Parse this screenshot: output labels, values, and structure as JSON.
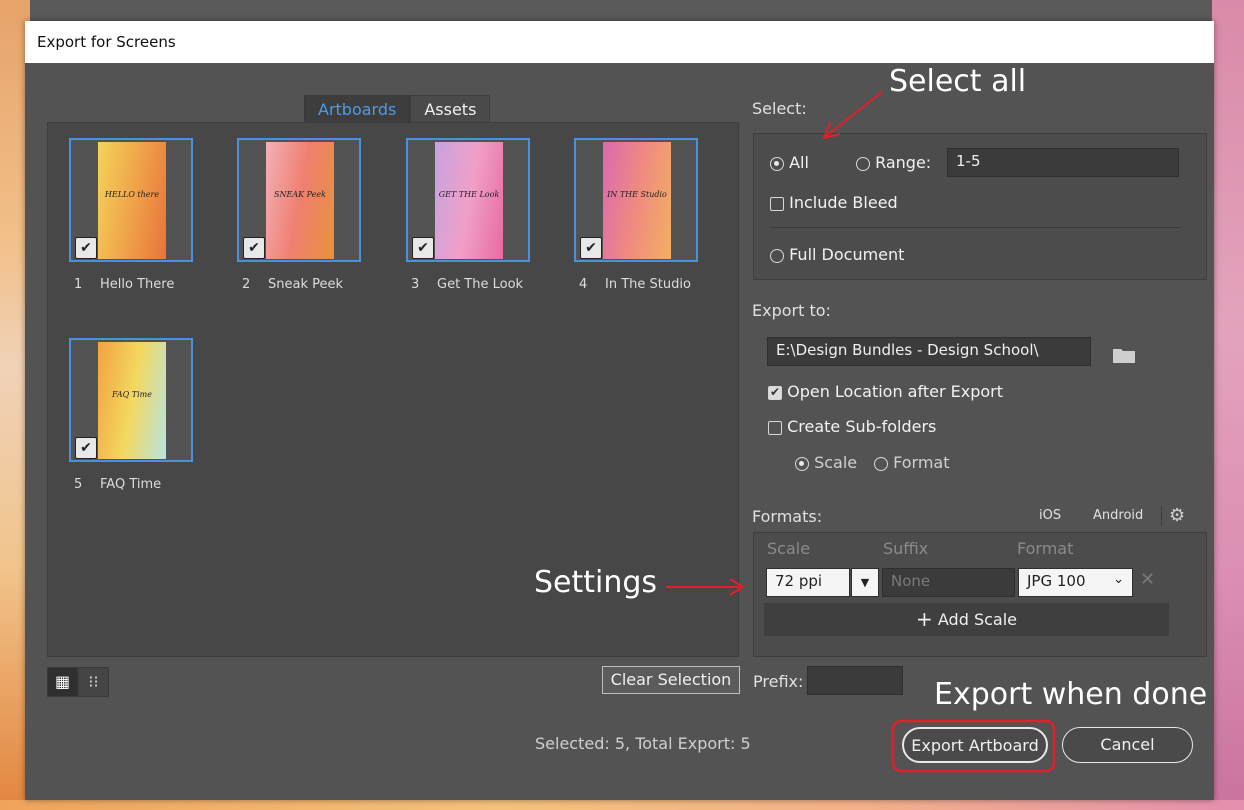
{
  "dialog": {
    "title": "Export for Screens"
  },
  "tabs": [
    "Artboards",
    "Assets"
  ],
  "artboards": [
    {
      "num": "1",
      "name": "Hello There",
      "checked": true,
      "art_word": "HELLO there",
      "colors": [
        "#f3d45a",
        "#f0a44a",
        "#e8733a"
      ]
    },
    {
      "num": "2",
      "name": "Sneak Peek",
      "checked": true,
      "art_word": "SNEAK Peek",
      "colors": [
        "#f4b0b8",
        "#ef7f70",
        "#e8923a"
      ]
    },
    {
      "num": "3",
      "name": "Get The Look",
      "checked": true,
      "art_word": "GET THE Look",
      "colors": [
        "#c7a3e0",
        "#f0a0c8",
        "#e86aa0"
      ]
    },
    {
      "num": "4",
      "name": "In The Studio",
      "checked": true,
      "art_word": "IN THE Studio",
      "colors": [
        "#d96ab0",
        "#f08a80",
        "#f2b060"
      ]
    },
    {
      "num": "5",
      "name": "FAQ Time",
      "checked": true,
      "art_word": "FAQ Time",
      "colors": [
        "#f2a240",
        "#f3d860",
        "#b8e4e0"
      ]
    }
  ],
  "bottom_left": {
    "clear_selection": "Clear Selection",
    "prefix_label": "Prefix:",
    "prefix_value": "",
    "status": "Selected: 5, Total Export: 5"
  },
  "select": {
    "label": "Select:",
    "all": "All",
    "range": "Range:",
    "range_value": "1-5",
    "include_bleed": "Include Bleed",
    "full_document": "Full Document"
  },
  "export_to": {
    "label": "Export to:",
    "path": "E:\\Design Bundles - Design School\\",
    "open_location": "Open Location after Export",
    "create_subfolders": "Create Sub-folders",
    "scale": "Scale",
    "format": "Format"
  },
  "formats": {
    "label": "Formats:",
    "ios": "iOS",
    "android": "Android",
    "col_scale": "Scale",
    "col_suffix": "Suffix",
    "col_format": "Format",
    "scale_value": "72 ppi",
    "suffix_placeholder": "None",
    "format_value": "JPG 100",
    "add_scale": "Add Scale"
  },
  "buttons": {
    "export": "Export Artboard",
    "cancel": "Cancel"
  },
  "annotations": {
    "select_all": "Select all",
    "settings": "Settings",
    "export_done": "Export when done"
  },
  "colors": {
    "accent": "#4d9be8",
    "annotation_red": "#e0202a"
  }
}
